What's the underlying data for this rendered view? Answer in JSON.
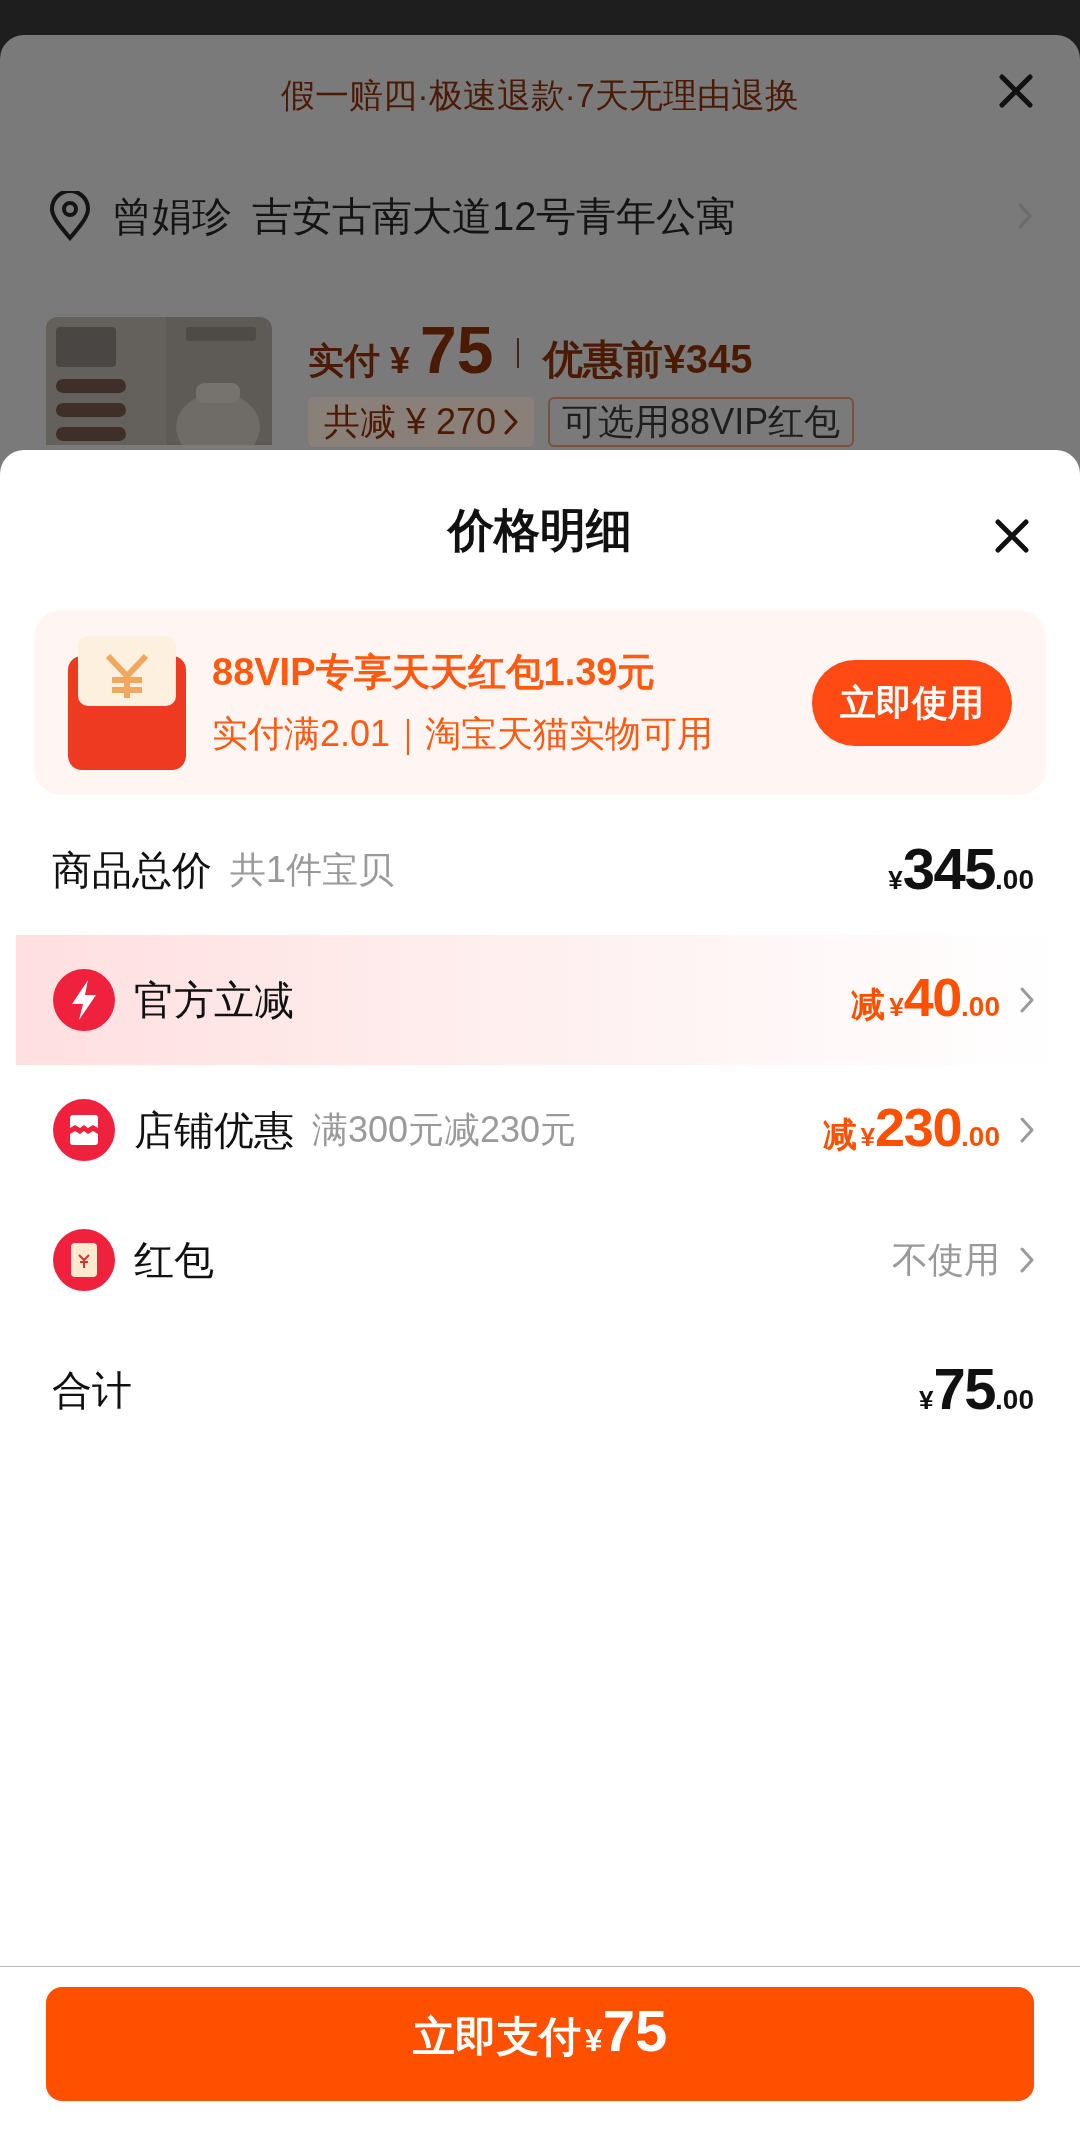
{
  "background_sheet": {
    "guarantee": "假一赔四·极速退款·7天无理由退换",
    "address": {
      "name": "曾娟珍",
      "detail": "吉安古南大道12号青年公寓"
    },
    "product": {
      "paid_label": "实付",
      "paid_currency": "¥",
      "paid_amount": "75",
      "original_price": "优惠前¥345",
      "reduction_tag": "共减 ¥ 270",
      "vip_tag": "可选用88VIP红包"
    }
  },
  "price_detail": {
    "title": "价格明细",
    "promo": {
      "title": "88VIP专享天天红包1.39元",
      "subtitle": "实付满2.01｜淘宝天猫实物可用",
      "button": "立即使用"
    },
    "rows": [
      {
        "kind": "subtotal",
        "label": "商品总价",
        "note": "共1件宝贝",
        "highlighted": false,
        "price": {
          "currency": "¥",
          "integer": "345",
          "decimal": ".00"
        }
      },
      {
        "kind": "official",
        "label": "官方立减",
        "highlighted": true,
        "prefix": "减",
        "price": {
          "currency": "¥",
          "integer": "40",
          "decimal": ".00"
        }
      },
      {
        "kind": "shop",
        "label": "店铺优惠",
        "note": "满300元减230元",
        "highlighted": false,
        "prefix": "减",
        "price": {
          "currency": "¥",
          "integer": "230",
          "decimal": ".00"
        }
      },
      {
        "kind": "packet",
        "label": "红包",
        "highlighted": false,
        "value": "不使用"
      },
      {
        "kind": "total",
        "label": "合计",
        "highlighted": false,
        "price": {
          "currency": "¥",
          "integer": "75",
          "decimal": ".00"
        }
      }
    ],
    "pay_button": {
      "label": "立即支付",
      "currency": "¥",
      "amount": "75"
    }
  }
}
